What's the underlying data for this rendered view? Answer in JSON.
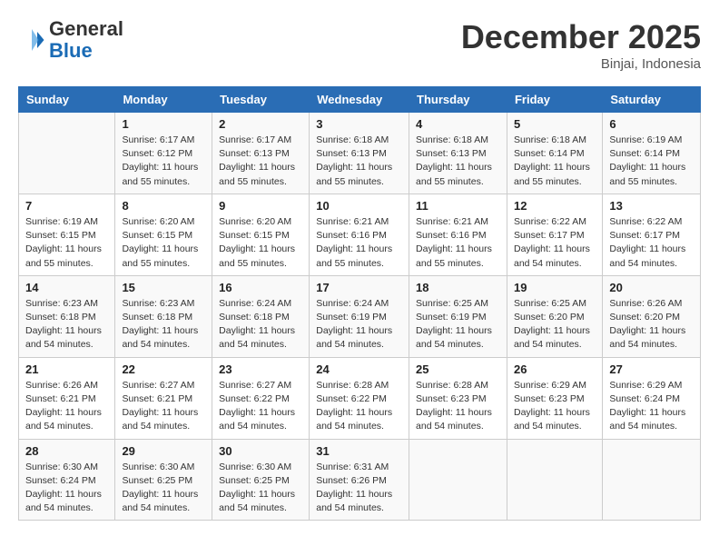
{
  "header": {
    "logo_general": "General",
    "logo_blue": "Blue",
    "month_title": "December 2025",
    "location": "Binjai, Indonesia"
  },
  "weekdays": [
    "Sunday",
    "Monday",
    "Tuesday",
    "Wednesday",
    "Thursday",
    "Friday",
    "Saturday"
  ],
  "rows": [
    [
      {
        "day": "",
        "sunrise": "",
        "sunset": "",
        "daylight": ""
      },
      {
        "day": "1",
        "sunrise": "Sunrise: 6:17 AM",
        "sunset": "Sunset: 6:12 PM",
        "daylight": "Daylight: 11 hours and 55 minutes."
      },
      {
        "day": "2",
        "sunrise": "Sunrise: 6:17 AM",
        "sunset": "Sunset: 6:13 PM",
        "daylight": "Daylight: 11 hours and 55 minutes."
      },
      {
        "day": "3",
        "sunrise": "Sunrise: 6:18 AM",
        "sunset": "Sunset: 6:13 PM",
        "daylight": "Daylight: 11 hours and 55 minutes."
      },
      {
        "day": "4",
        "sunrise": "Sunrise: 6:18 AM",
        "sunset": "Sunset: 6:13 PM",
        "daylight": "Daylight: 11 hours and 55 minutes."
      },
      {
        "day": "5",
        "sunrise": "Sunrise: 6:18 AM",
        "sunset": "Sunset: 6:14 PM",
        "daylight": "Daylight: 11 hours and 55 minutes."
      },
      {
        "day": "6",
        "sunrise": "Sunrise: 6:19 AM",
        "sunset": "Sunset: 6:14 PM",
        "daylight": "Daylight: 11 hours and 55 minutes."
      }
    ],
    [
      {
        "day": "7",
        "sunrise": "Sunrise: 6:19 AM",
        "sunset": "Sunset: 6:15 PM",
        "daylight": "Daylight: 11 hours and 55 minutes."
      },
      {
        "day": "8",
        "sunrise": "Sunrise: 6:20 AM",
        "sunset": "Sunset: 6:15 PM",
        "daylight": "Daylight: 11 hours and 55 minutes."
      },
      {
        "day": "9",
        "sunrise": "Sunrise: 6:20 AM",
        "sunset": "Sunset: 6:15 PM",
        "daylight": "Daylight: 11 hours and 55 minutes."
      },
      {
        "day": "10",
        "sunrise": "Sunrise: 6:21 AM",
        "sunset": "Sunset: 6:16 PM",
        "daylight": "Daylight: 11 hours and 55 minutes."
      },
      {
        "day": "11",
        "sunrise": "Sunrise: 6:21 AM",
        "sunset": "Sunset: 6:16 PM",
        "daylight": "Daylight: 11 hours and 55 minutes."
      },
      {
        "day": "12",
        "sunrise": "Sunrise: 6:22 AM",
        "sunset": "Sunset: 6:17 PM",
        "daylight": "Daylight: 11 hours and 54 minutes."
      },
      {
        "day": "13",
        "sunrise": "Sunrise: 6:22 AM",
        "sunset": "Sunset: 6:17 PM",
        "daylight": "Daylight: 11 hours and 54 minutes."
      }
    ],
    [
      {
        "day": "14",
        "sunrise": "Sunrise: 6:23 AM",
        "sunset": "Sunset: 6:18 PM",
        "daylight": "Daylight: 11 hours and 54 minutes."
      },
      {
        "day": "15",
        "sunrise": "Sunrise: 6:23 AM",
        "sunset": "Sunset: 6:18 PM",
        "daylight": "Daylight: 11 hours and 54 minutes."
      },
      {
        "day": "16",
        "sunrise": "Sunrise: 6:24 AM",
        "sunset": "Sunset: 6:18 PM",
        "daylight": "Daylight: 11 hours and 54 minutes."
      },
      {
        "day": "17",
        "sunrise": "Sunrise: 6:24 AM",
        "sunset": "Sunset: 6:19 PM",
        "daylight": "Daylight: 11 hours and 54 minutes."
      },
      {
        "day": "18",
        "sunrise": "Sunrise: 6:25 AM",
        "sunset": "Sunset: 6:19 PM",
        "daylight": "Daylight: 11 hours and 54 minutes."
      },
      {
        "day": "19",
        "sunrise": "Sunrise: 6:25 AM",
        "sunset": "Sunset: 6:20 PM",
        "daylight": "Daylight: 11 hours and 54 minutes."
      },
      {
        "day": "20",
        "sunrise": "Sunrise: 6:26 AM",
        "sunset": "Sunset: 6:20 PM",
        "daylight": "Daylight: 11 hours and 54 minutes."
      }
    ],
    [
      {
        "day": "21",
        "sunrise": "Sunrise: 6:26 AM",
        "sunset": "Sunset: 6:21 PM",
        "daylight": "Daylight: 11 hours and 54 minutes."
      },
      {
        "day": "22",
        "sunrise": "Sunrise: 6:27 AM",
        "sunset": "Sunset: 6:21 PM",
        "daylight": "Daylight: 11 hours and 54 minutes."
      },
      {
        "day": "23",
        "sunrise": "Sunrise: 6:27 AM",
        "sunset": "Sunset: 6:22 PM",
        "daylight": "Daylight: 11 hours and 54 minutes."
      },
      {
        "day": "24",
        "sunrise": "Sunrise: 6:28 AM",
        "sunset": "Sunset: 6:22 PM",
        "daylight": "Daylight: 11 hours and 54 minutes."
      },
      {
        "day": "25",
        "sunrise": "Sunrise: 6:28 AM",
        "sunset": "Sunset: 6:23 PM",
        "daylight": "Daylight: 11 hours and 54 minutes."
      },
      {
        "day": "26",
        "sunrise": "Sunrise: 6:29 AM",
        "sunset": "Sunset: 6:23 PM",
        "daylight": "Daylight: 11 hours and 54 minutes."
      },
      {
        "day": "27",
        "sunrise": "Sunrise: 6:29 AM",
        "sunset": "Sunset: 6:24 PM",
        "daylight": "Daylight: 11 hours and 54 minutes."
      }
    ],
    [
      {
        "day": "28",
        "sunrise": "Sunrise: 6:30 AM",
        "sunset": "Sunset: 6:24 PM",
        "daylight": "Daylight: 11 hours and 54 minutes."
      },
      {
        "day": "29",
        "sunrise": "Sunrise: 6:30 AM",
        "sunset": "Sunset: 6:25 PM",
        "daylight": "Daylight: 11 hours and 54 minutes."
      },
      {
        "day": "30",
        "sunrise": "Sunrise: 6:30 AM",
        "sunset": "Sunset: 6:25 PM",
        "daylight": "Daylight: 11 hours and 54 minutes."
      },
      {
        "day": "31",
        "sunrise": "Sunrise: 6:31 AM",
        "sunset": "Sunset: 6:26 PM",
        "daylight": "Daylight: 11 hours and 54 minutes."
      },
      {
        "day": "",
        "sunrise": "",
        "sunset": "",
        "daylight": ""
      },
      {
        "day": "",
        "sunrise": "",
        "sunset": "",
        "daylight": ""
      },
      {
        "day": "",
        "sunrise": "",
        "sunset": "",
        "daylight": ""
      }
    ]
  ]
}
